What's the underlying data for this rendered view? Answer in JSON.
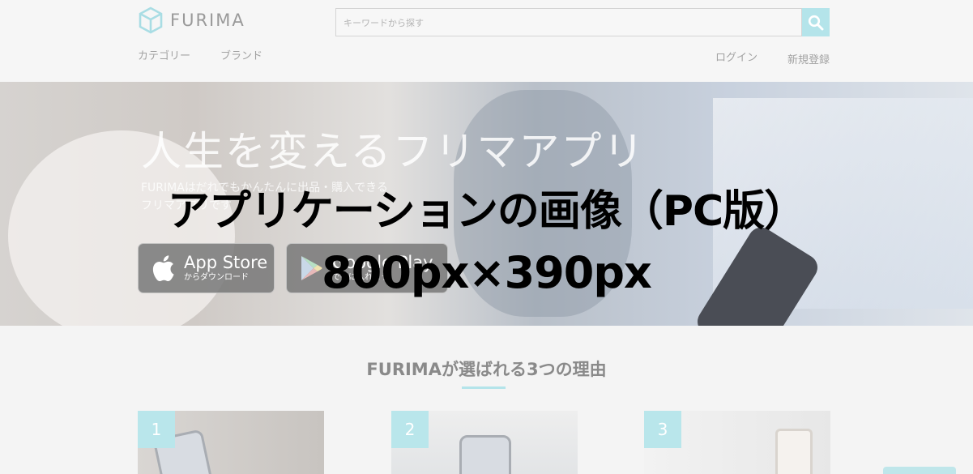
{
  "header": {
    "logo_text": "FURIMA",
    "search_placeholder": "キーワードから探す",
    "nav_left": [
      "カテゴリー",
      "ブランド"
    ],
    "nav_right": [
      "ログイン",
      "新規登録"
    ]
  },
  "hero": {
    "title": "人生を変えるフリマアプリ",
    "subtitle_line1": "FURIMAはだれでもかんたんに出品・購入できる",
    "subtitle_line2": "フリマアプリです",
    "app_store_main": "App Store",
    "app_store_sub": "からダウンロード",
    "google_play_main": "Google Play",
    "google_play_sub": "で手に入れよう"
  },
  "placeholder": {
    "title": "アプリケーションの画像（PC版）",
    "size": "800px×390px"
  },
  "reasons": {
    "title": "FURIMAが選ばれる3つの理由",
    "cards": [
      {
        "number": "1"
      },
      {
        "number": "2"
      },
      {
        "number": "3"
      }
    ]
  },
  "colors": {
    "accent": "#b4e4ea",
    "text_muted": "#a2a2a2"
  },
  "icons": {
    "search": "search-icon",
    "logo": "box-logo-icon",
    "apple": "apple-icon",
    "google_play": "google-play-icon"
  }
}
